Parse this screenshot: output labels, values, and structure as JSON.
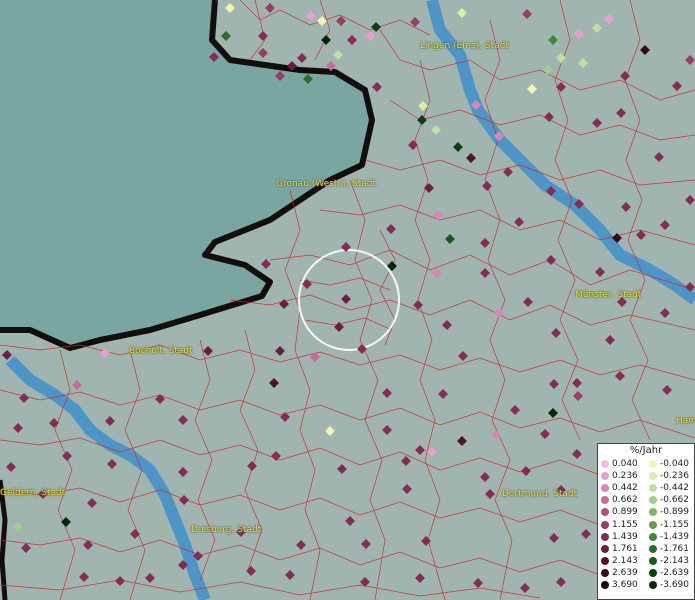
{
  "legend": {
    "title": "%/Jahr",
    "rows": [
      {
        "pos": "0.040",
        "pos_color": "#f6b8e6",
        "neg": "-0.040",
        "neg_color": "#f2f6b0"
      },
      {
        "pos": "0.236",
        "pos_color": "#e89ed4",
        "neg": "-0.236",
        "neg_color": "#dcecaa"
      },
      {
        "pos": "0.442",
        "pos_color": "#d886b8",
        "neg": "-0.442",
        "neg_color": "#c0e0a0"
      },
      {
        "pos": "0.662",
        "pos_color": "#c46c9c",
        "neg": "-0.662",
        "neg_color": "#a0d088"
      },
      {
        "pos": "0.899",
        "pos_color": "#b05080",
        "neg": "-0.899",
        "neg_color": "#7cb868"
      },
      {
        "pos": "1.155",
        "pos_color": "#9a3c68",
        "neg": "-1.155",
        "neg_color": "#5ca04c"
      },
      {
        "pos": "1.439",
        "pos_color": "#842c54",
        "neg": "-1.439",
        "neg_color": "#3e8838"
      },
      {
        "pos": "1.761",
        "pos_color": "#6c1e40",
        "neg": "-1.761",
        "neg_color": "#287028"
      },
      {
        "pos": "2.143",
        "pos_color": "#52122c",
        "neg": "-2.143",
        "neg_color": "#18581c"
      },
      {
        "pos": "2.639",
        "pos_color": "#380a1c",
        "neg": "-2.639",
        "neg_color": "#0c4010"
      },
      {
        "pos": "3.690",
        "pos_color": "#1e040e",
        "neg": "-3.690",
        "neg_color": "#042808"
      }
    ]
  },
  "cities": [
    {
      "name": "Lingen (Ems), Stadt"
    },
    {
      "name": "Gronau (Westf.), Stadt"
    },
    {
      "name": "Münster, Stadt"
    },
    {
      "name": "Bocholt, Stadt"
    },
    {
      "name": "Geldern, Stadt"
    },
    {
      "name": "Dortmund, Stadt"
    },
    {
      "name": "Duisburg, Stadt"
    },
    {
      "name": "Ham"
    }
  ],
  "colors": {
    "sea": "#7fa3a0",
    "land": "#9fb3ae",
    "border": "#cc2a2a",
    "river": "#3a8ec8",
    "national_border": "#151010",
    "label": "#f0e030"
  }
}
